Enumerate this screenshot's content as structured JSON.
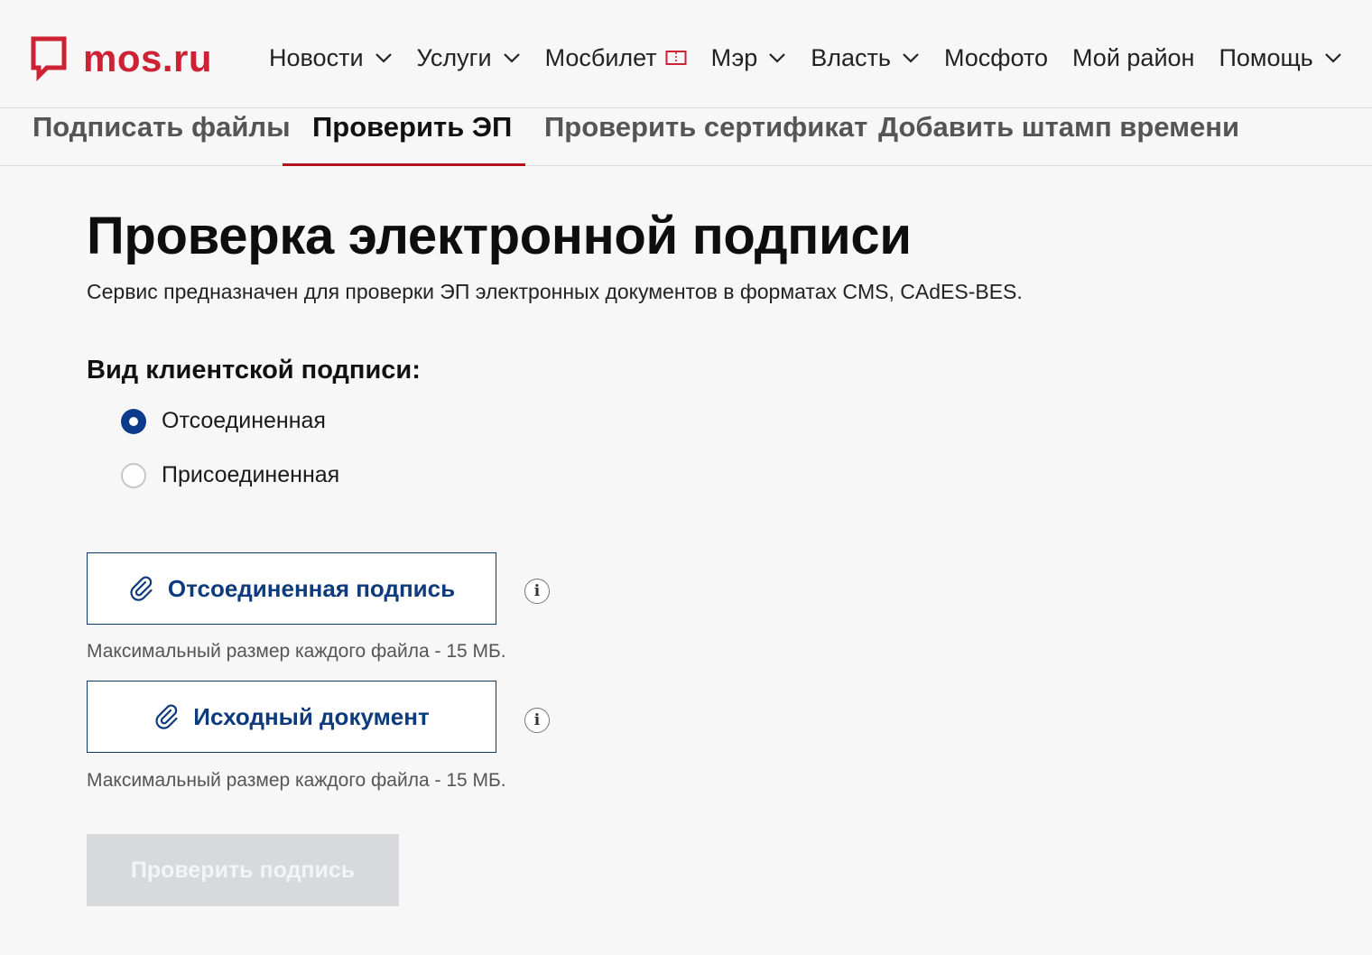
{
  "header": {
    "logo_text": "mos.ru",
    "nav": [
      {
        "label": "Новости",
        "icon": "chevron-down-icon"
      },
      {
        "label": "Услуги",
        "icon": "chevron-down-icon"
      },
      {
        "label": "Мосбилет",
        "icon": "ticket-icon"
      },
      {
        "label": "Мэр",
        "icon": "chevron-down-icon"
      },
      {
        "label": "Власть",
        "icon": "chevron-down-icon"
      },
      {
        "label": "Мосфото",
        "icon": ""
      },
      {
        "label": "Мой район",
        "icon": ""
      },
      {
        "label": "Помощь",
        "icon": "chevron-down-icon"
      }
    ]
  },
  "tabs": [
    {
      "label": "Подписать файлы",
      "active": false
    },
    {
      "label": "Проверить ЭП",
      "active": true
    },
    {
      "label": "Проверить сертификат",
      "active": false
    },
    {
      "label": "Добавить штамп времени",
      "active": false
    }
  ],
  "main": {
    "title": "Проверка электронной подписи",
    "subtitle": "Сервис предназначен для проверки ЭП электронных документов в форматах CMS, CAdES-BES.",
    "signature_type": {
      "label": "Вид клиентской подписи:",
      "options": [
        {
          "label": "Отсоединенная",
          "checked": true
        },
        {
          "label": "Присоединенная",
          "checked": false
        }
      ]
    },
    "uploads": [
      {
        "label": "Отсоединенная подпись",
        "hint": "Максимальный размер каждого файла - 15 МБ.",
        "info": "i"
      },
      {
        "label": "Исходный документ",
        "hint": "Максимальный размер каждого файла - 15 МБ.",
        "info": "i"
      }
    ],
    "submit_label": "Проверить подпись"
  },
  "colors": {
    "brand_red": "#cc2233",
    "tab_underline": "#b3121f",
    "primary_blue": "#0d3b8c",
    "disabled_button": "#d7d9dc"
  }
}
